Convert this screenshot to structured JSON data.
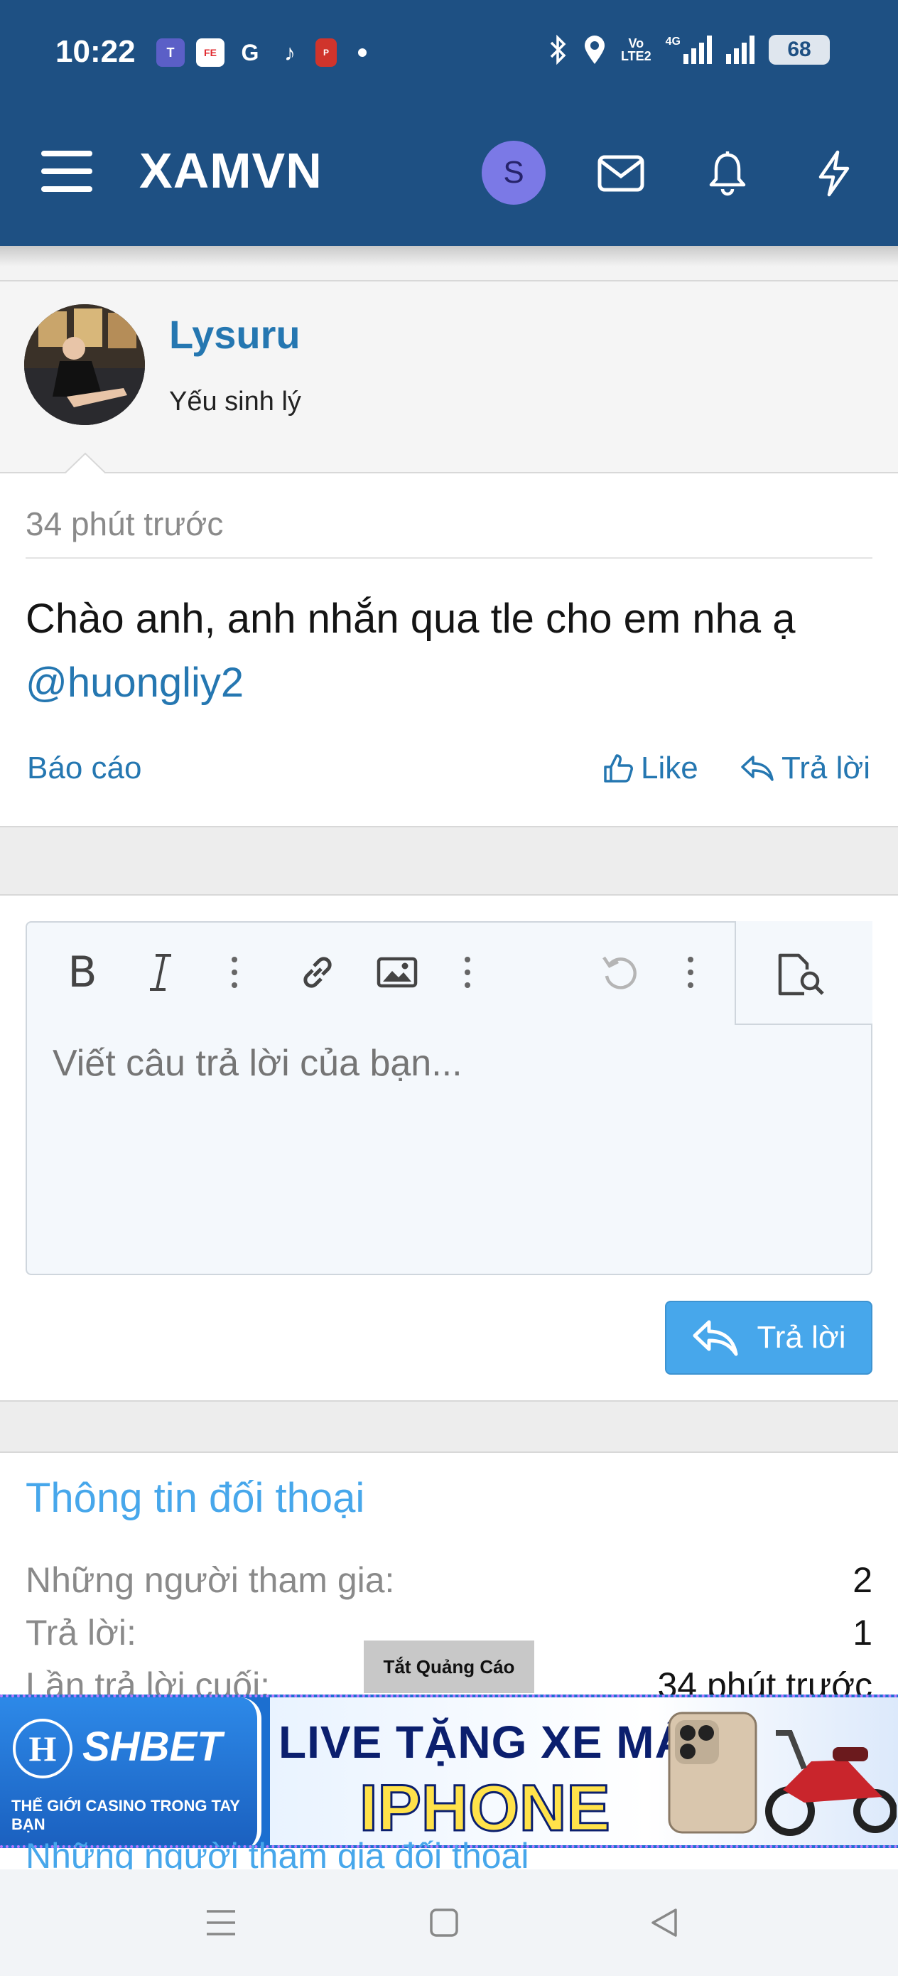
{
  "status_bar": {
    "time": "10:22",
    "battery": "68",
    "network": "4G"
  },
  "header": {
    "logo": "XAMVN",
    "avatar_letter": "S"
  },
  "message": {
    "username": "Lysuru",
    "user_title": "Yếu sinh lý",
    "time": "34 phút trước",
    "text": "Chào anh, anh nhắn qua tle cho em nha ạ",
    "mention": "@huongliy2",
    "report_label": "Báo cáo",
    "like_label": "Like",
    "reply_label": "Trả lời"
  },
  "editor": {
    "placeholder": "Viết câu trả lời của bạn...",
    "submit_label": "Trả lời"
  },
  "info": {
    "title": "Thông tin đối thoại",
    "rows": [
      {
        "label": "Những người tham gia:",
        "value": "2"
      },
      {
        "label": "Trả lời:",
        "value": "1"
      },
      {
        "label": "Lần trả lời cuối:",
        "value": "34 phút trước"
      }
    ],
    "next_section": "Những người tham gia đối thoại"
  },
  "ad": {
    "close_label": "Tắt Quảng Cáo",
    "brand": "SHBET",
    "tagline": "THẾ GIỚI CASINO TRONG TAY BẠN",
    "headline": "LIVE TẶNG XE MÁY",
    "subheadline": "IPHONE"
  },
  "colors": {
    "header_bg": "#1e5083",
    "link": "#2577b1",
    "accent": "#47a7eb"
  }
}
